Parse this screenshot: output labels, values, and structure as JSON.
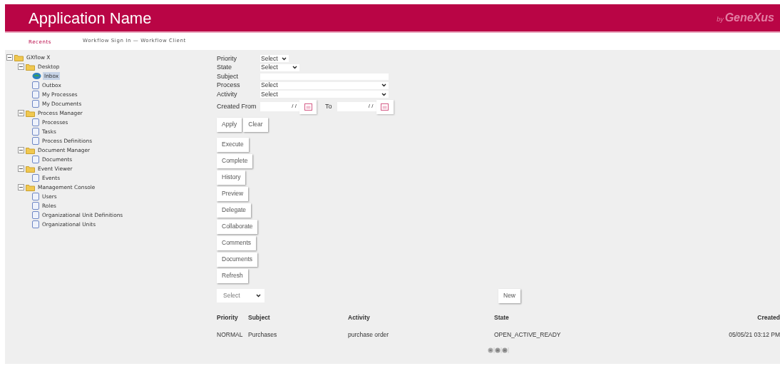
{
  "header": {
    "title": "Application Name",
    "logo_prefix": "by",
    "logo": "GeneXus"
  },
  "nav": [
    {
      "label": "Recents",
      "selected": true
    },
    {
      "label": "Workflow Sign In — Workflow Client",
      "selected": false
    }
  ],
  "tree": [
    {
      "label": "GXflow X",
      "kind": "folder",
      "expanded": true,
      "selected": false,
      "children": [
        {
          "label": "Desktop",
          "kind": "folder",
          "expanded": true,
          "selected": false,
          "children": [
            {
              "label": "Inbox",
              "kind": "inbox",
              "selected": true
            },
            {
              "label": "Outbox",
              "kind": "page",
              "selected": false
            },
            {
              "label": "My Processes",
              "kind": "page",
              "selected": false
            },
            {
              "label": "My Documents",
              "kind": "page",
              "selected": false
            }
          ]
        },
        {
          "label": "Process Manager",
          "kind": "folder",
          "expanded": true,
          "selected": false,
          "children": [
            {
              "label": "Processes",
              "kind": "page",
              "selected": false
            },
            {
              "label": "Tasks",
              "kind": "page",
              "selected": false
            },
            {
              "label": "Process Definitions",
              "kind": "page",
              "selected": false
            }
          ]
        },
        {
          "label": "Document Manager",
          "kind": "folder",
          "expanded": true,
          "selected": false,
          "children": [
            {
              "label": "Documents",
              "kind": "page",
              "selected": false
            }
          ]
        },
        {
          "label": "Event Viewer",
          "kind": "folder",
          "expanded": true,
          "selected": false,
          "children": [
            {
              "label": "Events",
              "kind": "page",
              "selected": false
            }
          ]
        },
        {
          "label": "Management Console",
          "kind": "folder",
          "expanded": true,
          "selected": false,
          "children": [
            {
              "label": "Users",
              "kind": "page",
              "selected": false
            },
            {
              "label": "Roles",
              "kind": "page",
              "selected": false
            },
            {
              "label": "Organizational Unit Definitions",
              "kind": "page",
              "selected": false
            },
            {
              "label": "Organizational Units",
              "kind": "page",
              "selected": false
            }
          ]
        }
      ]
    }
  ],
  "filters": [
    {
      "label": "Priority",
      "kind": "select",
      "value": "Select"
    },
    {
      "label": "State",
      "kind": "select",
      "value": "Select"
    },
    {
      "label": "Subject",
      "kind": "text"
    },
    {
      "label": "Process",
      "kind": "select",
      "value": "Select"
    },
    {
      "label": "Activity",
      "kind": "select",
      "value": "Select"
    },
    {
      "label": "Created From",
      "kind": "daterange",
      "value": "/ /",
      "to_label": "To",
      "to_value": "/ /"
    }
  ],
  "filter_buttons": [
    "Apply",
    "Clear"
  ],
  "actions": [
    "Execute",
    "Complete",
    "History",
    "Preview",
    "Delegate",
    "Collaborate",
    "Comments",
    "Documents",
    "Refresh"
  ],
  "bulk_select": {
    "value": "Select"
  },
  "new_button": "New",
  "table": {
    "columns": [
      "Priority",
      "Subject",
      "Activity",
      "State",
      "Created"
    ],
    "rows": [
      [
        "NORMAL",
        "Purchases",
        "purchase order",
        "OPEN_ACTIVE_READY",
        "05/05/21 03:12 PM"
      ]
    ]
  }
}
